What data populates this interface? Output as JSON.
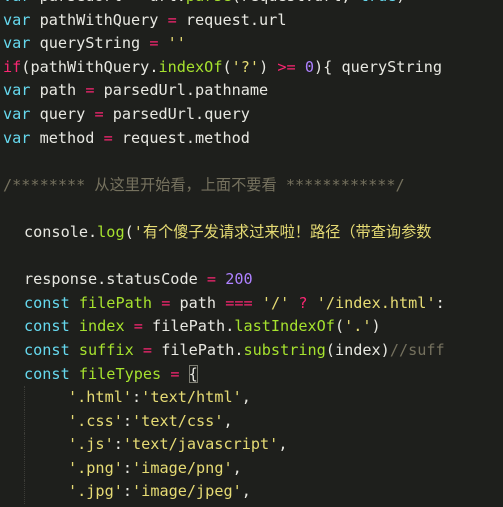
{
  "lines": [
    {
      "t": [
        [
          "kw",
          "var"
        ],
        [
          "id",
          " parsedUrl "
        ],
        [
          "op",
          "="
        ],
        [
          "id",
          " url."
        ],
        [
          "fn",
          "parse"
        ],
        [
          "punct",
          "("
        ],
        [
          "id",
          "request.url, "
        ],
        [
          "kw",
          "true"
        ],
        [
          "punct",
          ")"
        ]
      ]
    },
    {
      "t": [
        [
          "kw",
          "var"
        ],
        [
          "id",
          " pathWithQuery "
        ],
        [
          "op",
          "="
        ],
        [
          "id",
          " request.url"
        ]
      ]
    },
    {
      "t": [
        [
          "kw",
          "var"
        ],
        [
          "id",
          " queryString "
        ],
        [
          "op",
          "="
        ],
        [
          "id",
          " "
        ],
        [
          "str",
          "''"
        ]
      ]
    },
    {
      "t": [
        [
          "op",
          "if"
        ],
        [
          "punct",
          "("
        ],
        [
          "id",
          "pathWithQuery."
        ],
        [
          "fn",
          "indexOf"
        ],
        [
          "punct",
          "("
        ],
        [
          "str",
          "'?'"
        ],
        [
          "punct",
          ")"
        ],
        [
          "id",
          " "
        ],
        [
          "op",
          ">="
        ],
        [
          "id",
          " "
        ],
        [
          "num",
          "0"
        ],
        [
          "punct",
          ")"
        ],
        [
          "id",
          "{ queryString"
        ]
      ]
    },
    {
      "t": [
        [
          "kw",
          "var"
        ],
        [
          "id",
          " path "
        ],
        [
          "op",
          "="
        ],
        [
          "id",
          " parsedUrl.pathname"
        ]
      ]
    },
    {
      "t": [
        [
          "kw",
          "var"
        ],
        [
          "id",
          " query "
        ],
        [
          "op",
          "="
        ],
        [
          "id",
          " parsedUrl.query"
        ]
      ]
    },
    {
      "t": [
        [
          "kw",
          "var"
        ],
        [
          "id",
          " method "
        ],
        [
          "op",
          "="
        ],
        [
          "id",
          " request.method"
        ]
      ]
    },
    {
      "t": []
    },
    {
      "t": [
        [
          "cmt",
          "/******** 从这里开始看，上面不要看 ************/"
        ]
      ]
    },
    {
      "t": []
    },
    {
      "t": [
        [
          "id",
          "console."
        ],
        [
          "fn",
          "log"
        ],
        [
          "punct",
          "("
        ],
        [
          "str",
          "'有个傻子发请求过来啦！路径（带查询参数"
        ]
      ],
      "indent": 1
    },
    {
      "t": []
    },
    {
      "t": [
        [
          "id",
          "response.statusCode "
        ],
        [
          "op",
          "="
        ],
        [
          "id",
          " "
        ],
        [
          "num",
          "200"
        ]
      ],
      "indent": 1
    },
    {
      "t": [
        [
          "kw",
          "const"
        ],
        [
          "id",
          " "
        ],
        [
          "fn",
          "filePath"
        ],
        [
          "id",
          " "
        ],
        [
          "op",
          "="
        ],
        [
          "id",
          " path "
        ],
        [
          "op",
          "==="
        ],
        [
          "id",
          " "
        ],
        [
          "str",
          "'/'"
        ],
        [
          "id",
          " "
        ],
        [
          "op",
          "?"
        ],
        [
          "id",
          " "
        ],
        [
          "str",
          "'/index.html'"
        ],
        [
          "id",
          ":"
        ]
      ],
      "indent": 1
    },
    {
      "t": [
        [
          "kw",
          "const"
        ],
        [
          "id",
          " "
        ],
        [
          "fn",
          "index"
        ],
        [
          "id",
          " "
        ],
        [
          "op",
          "="
        ],
        [
          "id",
          " filePath."
        ],
        [
          "fn",
          "lastIndexOf"
        ],
        [
          "punct",
          "("
        ],
        [
          "str",
          "'.'"
        ],
        [
          "punct",
          ")"
        ]
      ],
      "indent": 1
    },
    {
      "t": [
        [
          "kw",
          "const"
        ],
        [
          "id",
          " "
        ],
        [
          "fn",
          "suffix"
        ],
        [
          "id",
          " "
        ],
        [
          "op",
          "="
        ],
        [
          "id",
          " filePath."
        ],
        [
          "fn",
          "substring"
        ],
        [
          "punct",
          "("
        ],
        [
          "id",
          "index"
        ],
        [
          "punct",
          ")"
        ],
        [
          "cmt",
          "//suff"
        ]
      ],
      "indent": 1
    },
    {
      "t": [
        [
          "kw",
          "const"
        ],
        [
          "id",
          " "
        ],
        [
          "fn",
          "fileTypes"
        ],
        [
          "id",
          " "
        ],
        [
          "op",
          "="
        ],
        [
          "id",
          " "
        ],
        [
          "bracket",
          "{"
        ]
      ],
      "indent": 1
    },
    {
      "t": [
        [
          "str",
          "'.html'"
        ],
        [
          "id",
          ":"
        ],
        [
          "str",
          "'text/html'"
        ],
        [
          "id",
          ","
        ]
      ],
      "indent": 2
    },
    {
      "t": [
        [
          "str",
          "'.css'"
        ],
        [
          "id",
          ":"
        ],
        [
          "str",
          "'text/css'"
        ],
        [
          "id",
          ","
        ]
      ],
      "indent": 2
    },
    {
      "t": [
        [
          "str",
          "'.js'"
        ],
        [
          "id",
          ":"
        ],
        [
          "str",
          "'text/javascript'"
        ],
        [
          "id",
          ","
        ]
      ],
      "indent": 2
    },
    {
      "t": [
        [
          "str",
          "'.png'"
        ],
        [
          "id",
          ":"
        ],
        [
          "str",
          "'image/png'"
        ],
        [
          "id",
          ","
        ]
      ],
      "indent": 2
    },
    {
      "t": [
        [
          "str",
          "'.jpg'"
        ],
        [
          "id",
          ":"
        ],
        [
          "str",
          "'image/jpeg'"
        ],
        [
          "id",
          ","
        ]
      ],
      "indent": 2
    }
  ]
}
